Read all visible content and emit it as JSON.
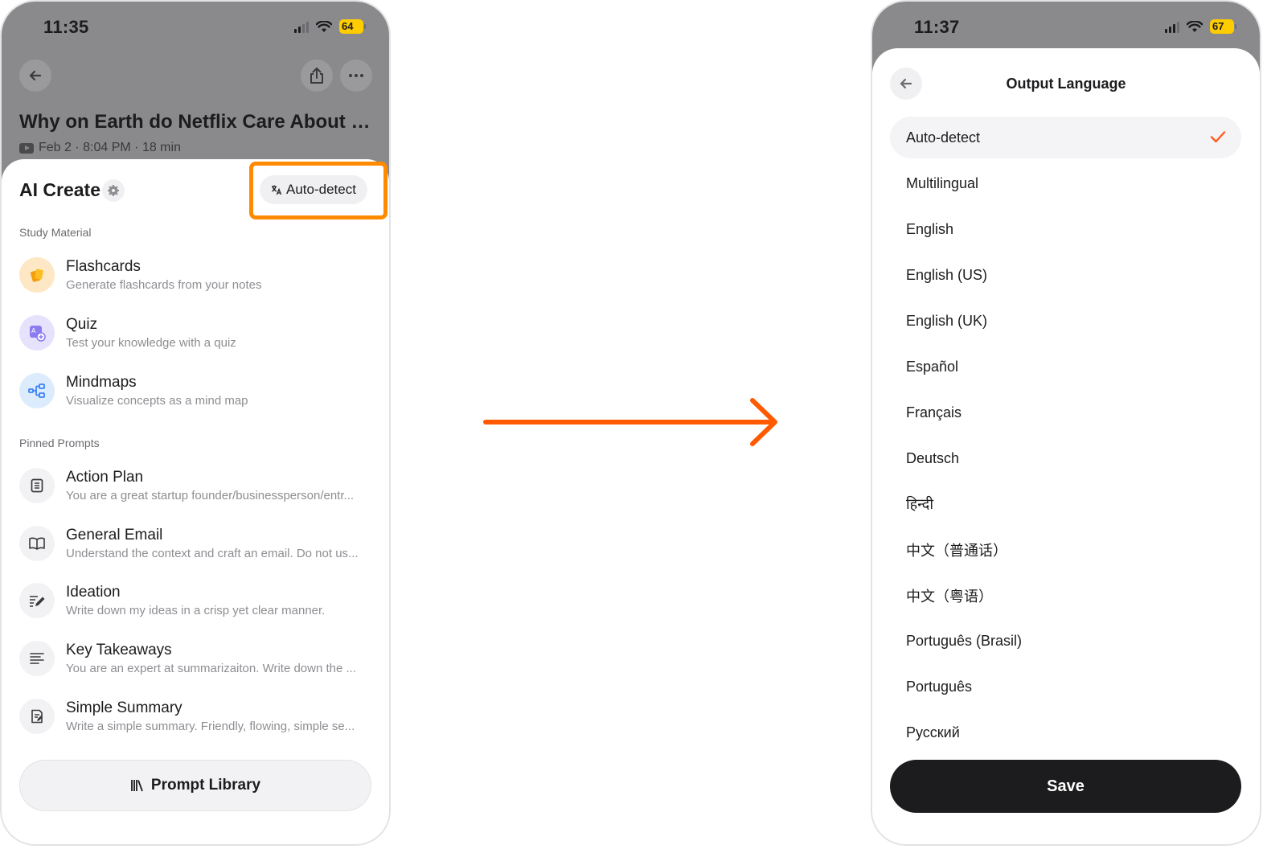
{
  "left_screen": {
    "status_bar": {
      "time": "11:35",
      "battery": "64"
    },
    "note": {
      "title": "Why on Earth do Netflix Care About Sp...",
      "meta": "Feb 2 · 8:04 PM · 18 min"
    },
    "sheet": {
      "title": "AI Create",
      "language_button": "Auto-detect",
      "study_section_label": "Study Material",
      "study_items": [
        {
          "title": "Flashcards",
          "subtitle": "Generate flashcards from your notes",
          "icon": "cards-icon"
        },
        {
          "title": "Quiz",
          "subtitle": "Test your knowledge with a quiz",
          "icon": "quiz-icon"
        },
        {
          "title": "Mindmaps",
          "subtitle": "Visualize concepts as a mind map",
          "icon": "mindmap-icon"
        }
      ],
      "pinned_section_label": "Pinned Prompts",
      "pinned_items": [
        {
          "title": "Action Plan",
          "subtitle": "You are a great startup founder/businessperson/entr...",
          "icon": "document-icon"
        },
        {
          "title": "General Email",
          "subtitle": "Understand the context and craft an email. Do not us...",
          "icon": "book-icon"
        },
        {
          "title": "Ideation",
          "subtitle": "Write down my ideas in a crisp yet clear manner.",
          "icon": "pencil-lines-icon"
        },
        {
          "title": "Key Takeaways",
          "subtitle": "You are an expert at summarizaiton. Write down the ...",
          "icon": "lines-icon"
        },
        {
          "title": "Simple Summary",
          "subtitle": "Write a simple summary. Friendly, flowing, simple se...",
          "icon": "summary-icon"
        }
      ],
      "library_button": "Prompt Library"
    }
  },
  "right_screen": {
    "status_bar": {
      "time": "11:37",
      "battery": "67"
    },
    "sheet_title": "Output Language",
    "selected_language": "Auto-detect",
    "languages": [
      "Auto-detect",
      "Multilingual",
      "English",
      "English (US)",
      "English (UK)",
      "Español",
      "Français",
      "Deutsch",
      "हिन्दी",
      "中文（普通话）",
      "中文（粤语）",
      "Português (Brasil)",
      "Português",
      "Русский"
    ],
    "save_button": "Save"
  },
  "colors": {
    "highlight": "#ff8a00",
    "arrow": "#ff5a00",
    "checkmark": "#ff5a1f",
    "dim_overlay": "#8a8a8c",
    "primary_dark": "#1c1c1e"
  }
}
